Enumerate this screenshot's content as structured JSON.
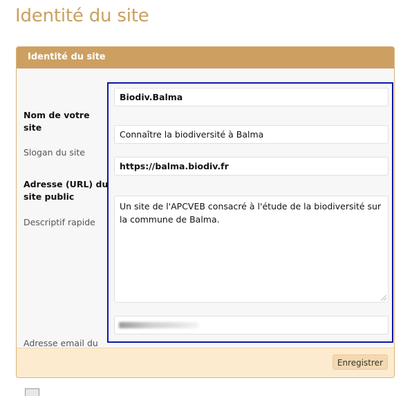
{
  "page": {
    "title": "Identité du site"
  },
  "panel": {
    "header": "Identité du site",
    "submit_label": "Enregistrer"
  },
  "fields": {
    "site_name": {
      "label": "Nom de votre site",
      "value": "Biodiv.Balma"
    },
    "slogan": {
      "label": "Slogan du site",
      "value": "Connaître la biodiversité à Balma"
    },
    "url": {
      "label": "Adresse (URL) du site public",
      "value": "https://balma.biodiv.fr"
    },
    "description": {
      "label": "Descriptif rapide",
      "value": "Un site de l'APCVEB consacré à l'étude de la biodiversité sur la commune de Balma."
    },
    "email": {
      "label": "Adresse email du webmestre",
      "value": ""
    }
  },
  "colors": {
    "accent": "#cda061",
    "title": "#caa05f",
    "highlight": "#0b17a6",
    "footer": "#fdebd0"
  }
}
